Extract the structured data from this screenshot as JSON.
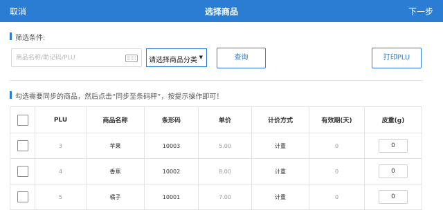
{
  "header": {
    "cancel_label": "取消",
    "title": "选择商品",
    "next_label": "下一步"
  },
  "filter": {
    "label": "筛选条件:",
    "search_placeholder": "商品名称/助记码/PLU",
    "search_value": "",
    "category_value": "请选择商品分类",
    "query_label": "查询",
    "print_label": "打印PLU"
  },
  "instruction": "勾选需要同步的商品，然后点击“同步至条码秤”，按提示操作即可！",
  "table": {
    "headers": {
      "plu": "PLU",
      "name": "商品名称",
      "barcode": "条形码",
      "price": "单价",
      "pricing": "计价方式",
      "validity": "有效期(天)",
      "tare": "皮重(g)"
    },
    "rows": [
      {
        "checked": false,
        "plu": "3",
        "name": "苹果",
        "barcode": "10003",
        "price": "5.00",
        "pricing": "计重",
        "validity": "0",
        "tare": "0"
      },
      {
        "checked": false,
        "plu": "4",
        "name": "香蕉",
        "barcode": "10002",
        "price": "8.00",
        "pricing": "计重",
        "validity": "0",
        "tare": "0"
      },
      {
        "checked": false,
        "plu": "5",
        "name": "橘子",
        "barcode": "10001",
        "price": "7.00",
        "pricing": "计重",
        "validity": "0",
        "tare": "0"
      }
    ]
  },
  "colors": {
    "brand": "#2b7dd3",
    "border": "#e3e3e3"
  },
  "icons": {
    "keyboard": "keyboard-icon",
    "caret": "caret-down-icon"
  }
}
